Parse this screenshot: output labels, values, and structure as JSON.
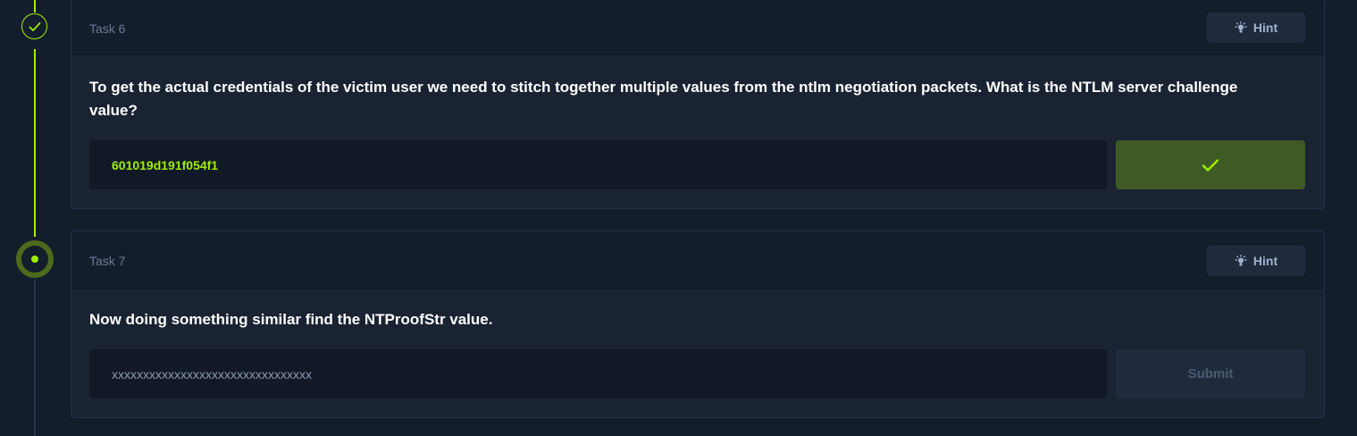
{
  "colors": {
    "background": "#141d2b",
    "card": "#1a2332",
    "accent": "#9fef00",
    "correct_button": "#3f5a24",
    "hint_button": "#1f2a3d"
  },
  "timeline": [
    {
      "status": "completed",
      "icon": "check-icon"
    },
    {
      "status": "active",
      "icon": "dot-icon"
    }
  ],
  "tasks": [
    {
      "label": "Task 6",
      "hint_label": "Hint",
      "hint_icon": "lightbulb-icon",
      "question": "To get the actual credentials of the victim user we need to stitch together multiple values from the ntlm negotiation packets. What is the NTLM server challenge value?",
      "answer_value": "601019d191f054f1",
      "submit_state": "correct",
      "submit_icon": "check-icon"
    },
    {
      "label": "Task 7",
      "hint_label": "Hint",
      "hint_icon": "lightbulb-icon",
      "question": "Now doing something similar find the NTProofStr value.",
      "answer_placeholder": "xxxxxxxxxxxxxxxxxxxxxxxxxxxxxxxx",
      "submit_label": "Submit",
      "submit_state": "disabled"
    }
  ]
}
